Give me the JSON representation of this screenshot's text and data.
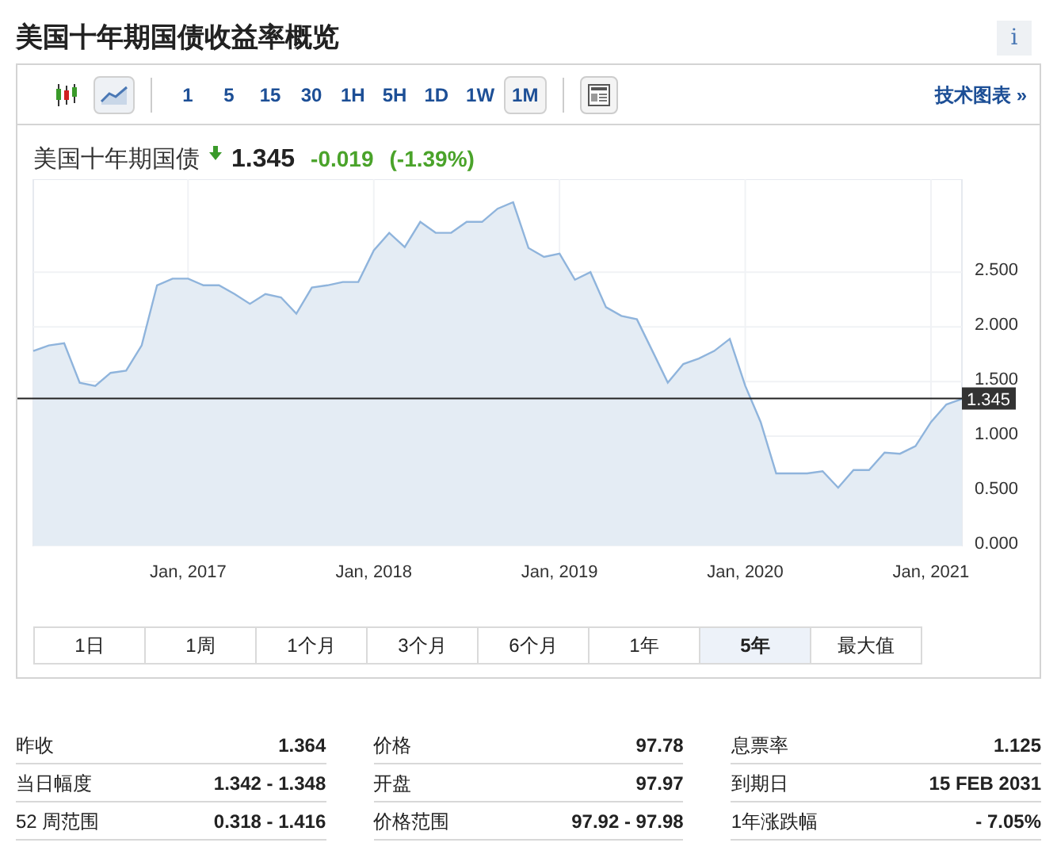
{
  "title": "美国十年期国债收益率概览",
  "info_button": "i",
  "toolbar": {
    "chart_types": [
      {
        "kind": "candlestick",
        "selected": false
      },
      {
        "kind": "line",
        "selected": true
      }
    ],
    "intervals": [
      {
        "label": "1",
        "selected": false
      },
      {
        "label": "5",
        "selected": false
      },
      {
        "label": "15",
        "selected": false
      },
      {
        "label": "30",
        "selected": false
      },
      {
        "label": "1H",
        "selected": false
      },
      {
        "label": "5H",
        "selected": false
      },
      {
        "label": "1D",
        "selected": false
      },
      {
        "label": "1W",
        "selected": false
      },
      {
        "label": "1M",
        "selected": true
      }
    ],
    "link": "技术图表 »"
  },
  "quote": {
    "name": "美国十年期国债",
    "falling": true,
    "price": "1.345",
    "change": "-0.019",
    "change_percent": "(-1.39%)"
  },
  "chart": {
    "chart_data": {
      "type": "area",
      "grid": true,
      "ylim": [
        0,
        3.35
      ],
      "yticks": [
        {
          "value": 0,
          "label": "0.000"
        },
        {
          "value": 0.5,
          "label": "0.500"
        },
        {
          "value": 1,
          "label": "1.000"
        },
        {
          "value": 1.5,
          "label": "1.500"
        },
        {
          "value": 2,
          "label": "2.000"
        },
        {
          "value": 2.5,
          "label": "2.500"
        }
      ],
      "categories": [
        null,
        null,
        null,
        null,
        null,
        null,
        null,
        null,
        null,
        null,
        "Jan, 2017",
        null,
        null,
        null,
        null,
        null,
        null,
        null,
        null,
        null,
        null,
        null,
        "Jan, 2018",
        null,
        null,
        null,
        null,
        null,
        null,
        null,
        null,
        null,
        null,
        null,
        "Jan, 2019",
        null,
        null,
        null,
        null,
        null,
        null,
        null,
        null,
        null,
        null,
        null,
        "Jan, 2020",
        null,
        null,
        null,
        null,
        null,
        null,
        null,
        null,
        null,
        null,
        null,
        "Jan, 2021",
        null,
        null
      ],
      "values": [
        1.78,
        1.83,
        1.85,
        1.49,
        1.46,
        1.58,
        1.6,
        1.83,
        2.38,
        2.44,
        2.44,
        2.38,
        2.38,
        2.3,
        2.21,
        2.3,
        2.27,
        2.12,
        2.36,
        2.38,
        2.41,
        2.41,
        2.7,
        2.86,
        2.73,
        2.96,
        2.86,
        2.86,
        2.96,
        2.96,
        3.08,
        3.14,
        2.72,
        2.64,
        2.67,
        2.43,
        2.5,
        2.18,
        2.1,
        2.07,
        1.78,
        1.49,
        1.66,
        1.71,
        1.78,
        1.89,
        1.46,
        1.13,
        0.66,
        0.66,
        0.66,
        0.68,
        0.53,
        0.69,
        0.69,
        0.85,
        0.84,
        0.91,
        1.13,
        1.29,
        1.34
      ],
      "ref_lines": [
        {
          "axis": "y",
          "value": 1.345,
          "label": "1.345"
        }
      ]
    }
  },
  "ranges": [
    {
      "label": "1日",
      "selected": false
    },
    {
      "label": "1周",
      "selected": false
    },
    {
      "label": "1个月",
      "selected": false
    },
    {
      "label": "3个月",
      "selected": false
    },
    {
      "label": "6个月",
      "selected": false
    },
    {
      "label": "1年",
      "selected": false
    },
    {
      "label": "5年",
      "selected": true
    },
    {
      "label": "最大值",
      "selected": false
    }
  ],
  "stats": [
    [
      {
        "label": "昨收",
        "value": "1.364"
      },
      {
        "label": "当日幅度",
        "value": "1.342 - 1.348"
      },
      {
        "label": "52 周范围",
        "value": "0.318 - 1.416"
      }
    ],
    [
      {
        "label": "价格",
        "value": "97.78"
      },
      {
        "label": "开盘",
        "value": "97.97"
      },
      {
        "label": "价格范围",
        "value": "97.92 - 97.98"
      }
    ],
    [
      {
        "label": "息票率",
        "value": "1.125"
      },
      {
        "label": "到期日",
        "value": "15 FEB 2031"
      },
      {
        "label": "1年涨跌幅",
        "value": "- 7.05%"
      }
    ]
  ]
}
